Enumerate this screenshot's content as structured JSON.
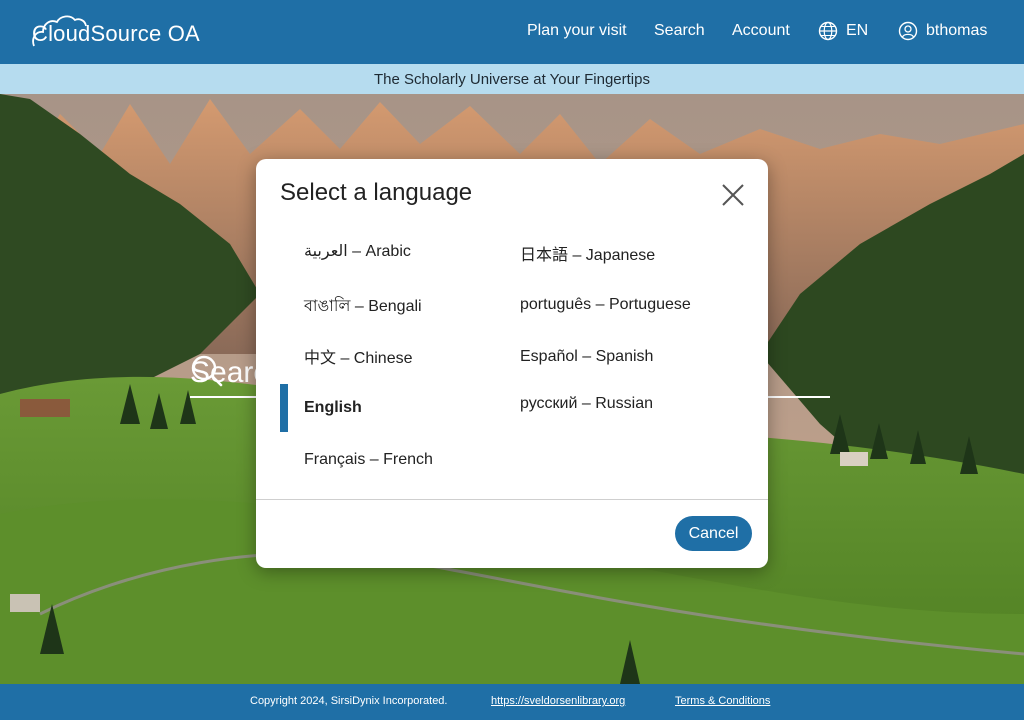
{
  "header": {
    "logo_text": "CloudSource OA",
    "nav": {
      "plan_visit": "Plan your visit",
      "search": "Search",
      "account": "Account",
      "language": "EN",
      "user": "bthomas"
    }
  },
  "tagline": "The Scholarly Universe at Your Fingertips",
  "hero": {
    "search_label": "Search"
  },
  "modal": {
    "title": "Select a language",
    "languages": {
      "arabic": "العربية – Arabic",
      "bengali": "বাঙালি – Bengali",
      "chinese": "中文 – Chinese",
      "english": "English",
      "french": "Français – French",
      "japanese": "日本語 – Japanese",
      "portuguese": "português – Portuguese",
      "spanish": "Español – Spanish",
      "russian": "русский – Russian"
    },
    "selected": "English",
    "cancel_label": "Cancel"
  },
  "footer": {
    "copyright": "Copyright 2024, SirsiDynix Incorporated.",
    "site_link": "https://sveldorsenlibrary.org",
    "terms": "Terms & Conditions"
  },
  "colors": {
    "brand_blue": "#1f6fa6",
    "tagline_bg": "#b6dcef"
  }
}
